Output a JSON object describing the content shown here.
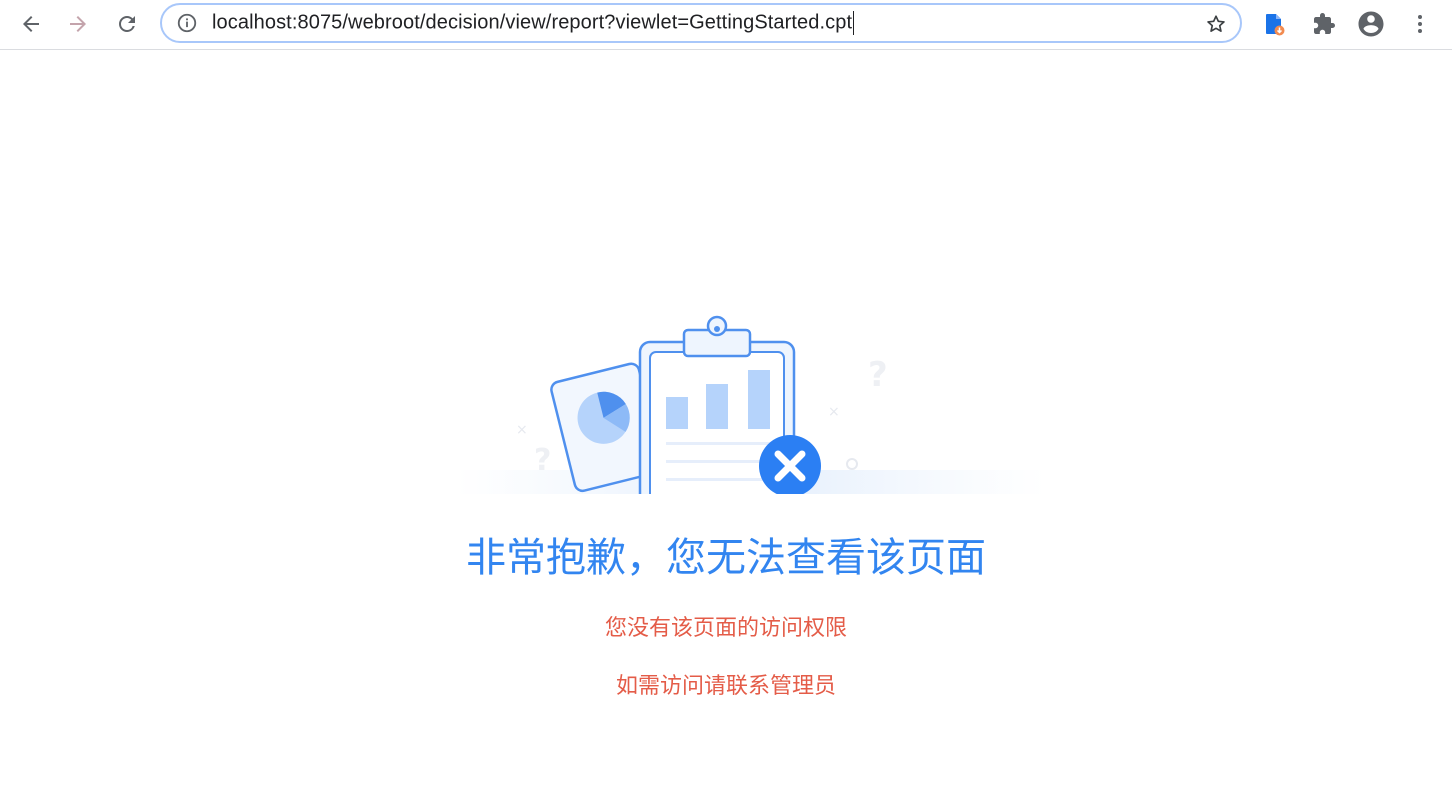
{
  "browser": {
    "url": "localhost:8075/webroot/decision/view/report?viewlet=GettingStarted.cpt",
    "icons": {
      "back": "arrow-left-icon",
      "forward": "arrow-right-icon",
      "reload": "reload-icon",
      "site_info": "info-icon",
      "bookmark": "star-icon",
      "extension_file": "file-download-icon",
      "extensions": "puzzle-icon",
      "profile": "account-circle-icon",
      "menu": "kebab-menu-icon"
    },
    "colors": {
      "omnibox_border": "#a8c7fa",
      "forward_arrow": "#c4a4ac"
    }
  },
  "page": {
    "title": "非常抱歉，您无法查看该页面",
    "message_line1": "您没有该页面的访问权限",
    "message_line2": "如需访问请联系管理员",
    "illustration_icon": "clipboard-error-icon",
    "colors": {
      "title": "#3285f0",
      "message": "#e45c48",
      "accent_blue": "#2b7ff3"
    }
  }
}
